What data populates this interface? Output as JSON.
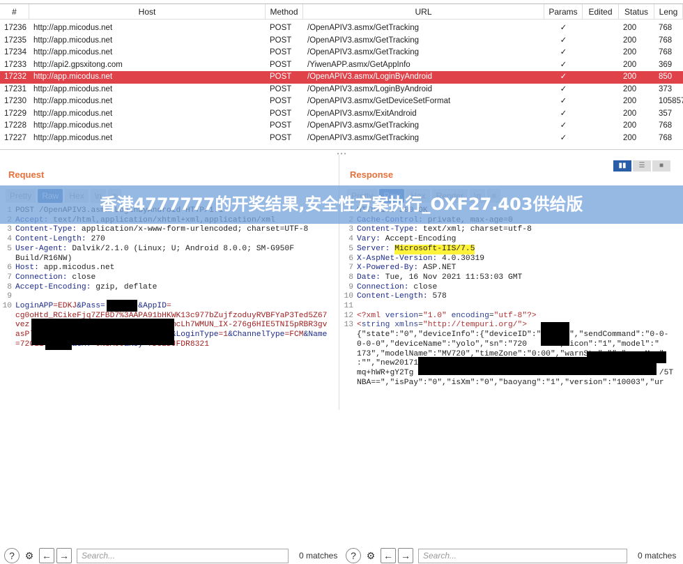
{
  "table": {
    "columns": [
      "#",
      "Host",
      "Method",
      "URL",
      "Params",
      "Edited",
      "Status",
      "Leng"
    ],
    "sort_icon": "chevron-down-icon",
    "rows": [
      {
        "id": "17236",
        "host": "http://app.micodus.net",
        "method": "POST",
        "url": "/OpenAPIV3.asmx/GetTracking",
        "params": "✓",
        "edited": "",
        "status": "200",
        "length": "768"
      },
      {
        "id": "17235",
        "host": "http://app.micodus.net",
        "method": "POST",
        "url": "/OpenAPIV3.asmx/GetTracking",
        "params": "✓",
        "edited": "",
        "status": "200",
        "length": "768"
      },
      {
        "id": "17234",
        "host": "http://app.micodus.net",
        "method": "POST",
        "url": "/OpenAPIV3.asmx/GetTracking",
        "params": "✓",
        "edited": "",
        "status": "200",
        "length": "768"
      },
      {
        "id": "17233",
        "host": "http://api2.gpsxitong.com",
        "method": "POST",
        "url": "/YiwenAPP.asmx/GetAppInfo",
        "params": "✓",
        "edited": "",
        "status": "200",
        "length": "369"
      },
      {
        "id": "17232",
        "host": "http://app.micodus.net",
        "method": "POST",
        "url": "/OpenAPIV3.asmx/LoginByAndroid",
        "params": "✓",
        "edited": "",
        "status": "200",
        "length": "850",
        "selected": true
      },
      {
        "id": "17231",
        "host": "http://app.micodus.net",
        "method": "POST",
        "url": "/OpenAPIV3.asmx/LoginByAndroid",
        "params": "✓",
        "edited": "",
        "status": "200",
        "length": "373"
      },
      {
        "id": "17230",
        "host": "http://app.micodus.net",
        "method": "POST",
        "url": "/OpenAPIV3.asmx/GetDeviceSetFormat",
        "params": "✓",
        "edited": "",
        "status": "200",
        "length": "105857"
      },
      {
        "id": "17229",
        "host": "http://app.micodus.net",
        "method": "POST",
        "url": "/OpenAPIV3.asmx/ExitAndroid",
        "params": "✓",
        "edited": "",
        "status": "200",
        "length": "357"
      },
      {
        "id": "17228",
        "host": "http://app.micodus.net",
        "method": "POST",
        "url": "/OpenAPIV3.asmx/GetTracking",
        "params": "✓",
        "edited": "",
        "status": "200",
        "length": "768"
      },
      {
        "id": "17227",
        "host": "http://app.micodus.net",
        "method": "POST",
        "url": "/OpenAPIV3.asmx/GetTracking",
        "params": "✓",
        "edited": "",
        "status": "200",
        "length": "768"
      }
    ]
  },
  "selected_color": "#e0424a",
  "banner": "香港4777777的开奖结果,安全性方案执行_OXF27.403供给版",
  "request": {
    "title": "Request",
    "tabs": [
      "Pretty",
      "Raw",
      "Hex",
      "\\n",
      "≡"
    ],
    "active_tab": "Raw",
    "lines": [
      {
        "n": "1",
        "seg": [
          {
            "c": "v",
            "t": "POST /OpenAPIV3.asmx/LoginByAndroid HTTP/1.1"
          }
        ]
      },
      {
        "n": "2",
        "seg": [
          {
            "c": "k",
            "t": "Accept: "
          },
          {
            "c": "v",
            "t": "text/html,application/xhtml+xml,application/xml"
          }
        ]
      },
      {
        "n": "3",
        "seg": [
          {
            "c": "k",
            "t": "Content-Type: "
          },
          {
            "c": "v",
            "t": "application/x-www-form-urlencoded; charset=UTF-8"
          }
        ]
      },
      {
        "n": "4",
        "seg": [
          {
            "c": "k",
            "t": "Content-Length: "
          },
          {
            "c": "v",
            "t": "270"
          }
        ]
      },
      {
        "n": "5",
        "seg": [
          {
            "c": "k",
            "t": "User-Agent: "
          },
          {
            "c": "v",
            "t": "Dalvik/2.1.0 (Linux; U; Android 8.0.0; SM-G950F"
          }
        ]
      },
      {
        "n": "",
        "seg": [
          {
            "c": "v",
            "t": "Build/R16NW)"
          }
        ]
      },
      {
        "n": "6",
        "seg": [
          {
            "c": "k",
            "t": "Host: "
          },
          {
            "c": "v",
            "t": "app.micodus.net"
          }
        ]
      },
      {
        "n": "7",
        "seg": [
          {
            "c": "k",
            "t": "Connection: "
          },
          {
            "c": "v",
            "t": "close"
          }
        ]
      },
      {
        "n": "8",
        "seg": [
          {
            "c": "k",
            "t": "Accept-Encoding: "
          },
          {
            "c": "v",
            "t": "gzip, deflate"
          }
        ]
      },
      {
        "n": "9",
        "seg": []
      },
      {
        "n": "10",
        "seg": [
          {
            "c": "k",
            "t": "LoginAPP"
          },
          {
            "c": "b",
            "t": "=EDKJ"
          },
          {
            "c": "k",
            "t": "&Pass="
          },
          {
            "c": "b",
            "t": "       "
          },
          {
            "c": "k",
            "t": "&AppID"
          },
          {
            "c": "b",
            "t": "="
          }
        ]
      },
      {
        "n": "",
        "seg": [
          {
            "c": "b",
            "t": "cg0oHtd_RCikeFjq7ZFBD7%3AAPA91bHKWK13c977bZujfzoduyRVBFYaP3Ted5Z67"
          }
        ]
      },
      {
        "n": "",
        "seg": [
          {
            "c": "b",
            "t": "vez                              mcLh7WMUN_IX-276g6HIE5TNI5pRBR3gv"
          }
        ]
      },
      {
        "n": "",
        "seg": [
          {
            "c": "b",
            "t": "asPlq                            "
          },
          {
            "c": "k",
            "t": "&LoginType"
          },
          {
            "c": "b",
            "t": "=1"
          },
          {
            "c": "k",
            "t": "&ChannelType"
          },
          {
            "c": "b",
            "t": "=FCM"
          },
          {
            "c": "k",
            "t": "&Name"
          }
        ]
      },
      {
        "n": "",
        "seg": [
          {
            "c": "b",
            "t": "=72011      "
          },
          {
            "c": "k",
            "t": "&GMT"
          },
          {
            "c": "b",
            "t": "=0%3A00"
          },
          {
            "c": "k",
            "t": "&Key"
          },
          {
            "c": "b",
            "t": "=7DU2DJFDR8321"
          }
        ]
      }
    ]
  },
  "response": {
    "title": "Response",
    "tabs": [
      "Pretty",
      "Raw",
      "Hex",
      "Render",
      "\\n",
      "≡"
    ],
    "active_tab": "Raw",
    "lines": [
      {
        "n": "1",
        "seg": [
          {
            "c": "v",
            "t": "HTTP/1.1 200 OK"
          }
        ]
      },
      {
        "n": "2",
        "seg": [
          {
            "c": "k",
            "t": "Cache-Control: "
          },
          {
            "c": "v",
            "t": "private, max-age=0"
          }
        ]
      },
      {
        "n": "3",
        "seg": [
          {
            "c": "k",
            "t": "Content-Type: "
          },
          {
            "c": "v",
            "t": "text/xml; charset=utf-8"
          }
        ]
      },
      {
        "n": "4",
        "seg": [
          {
            "c": "k",
            "t": "Vary: "
          },
          {
            "c": "v",
            "t": "Accept-Encoding"
          }
        ]
      },
      {
        "n": "5",
        "seg": [
          {
            "c": "k",
            "t": "Server: "
          },
          {
            "c": "hl",
            "t": "Microsoft-IIS/7.5"
          }
        ]
      },
      {
        "n": "6",
        "seg": [
          {
            "c": "k",
            "t": "X-AspNet-Version: "
          },
          {
            "c": "v",
            "t": "4.0.30319"
          }
        ]
      },
      {
        "n": "7",
        "seg": [
          {
            "c": "k",
            "t": "X-Powered-By: "
          },
          {
            "c": "v",
            "t": "ASP.NET"
          }
        ]
      },
      {
        "n": "8",
        "seg": [
          {
            "c": "k",
            "t": "Date: "
          },
          {
            "c": "v",
            "t": "Tue, 16 Nov 2021 11:53:03 GMT"
          }
        ]
      },
      {
        "n": "9",
        "seg": [
          {
            "c": "k",
            "t": "Connection: "
          },
          {
            "c": "v",
            "t": "close"
          }
        ]
      },
      {
        "n": "10",
        "seg": [
          {
            "c": "k",
            "t": "Content-Length: "
          },
          {
            "c": "v",
            "t": "578"
          }
        ]
      },
      {
        "n": "11",
        "seg": []
      },
      {
        "n": "12",
        "seg": [
          {
            "c": "s",
            "t": "<?xml "
          },
          {
            "c": "x",
            "t": "version"
          },
          {
            "c": "v",
            "t": "="
          },
          {
            "c": "s",
            "t": "\"1.0\" "
          },
          {
            "c": "x",
            "t": "encoding"
          },
          {
            "c": "v",
            "t": "="
          },
          {
            "c": "s",
            "t": "\"utf-8\"?>"
          }
        ]
      },
      {
        "n": "13",
        "seg": [
          {
            "c": "s",
            "t": "<"
          },
          {
            "c": "x",
            "t": "string xmlns"
          },
          {
            "c": "v",
            "t": "="
          },
          {
            "c": "s",
            "t": "\"http://tempuri.org/\">"
          }
        ]
      },
      {
        "n": "",
        "seg": [
          {
            "c": "v",
            "t": "{\"state\":\"0\",\"deviceInfo\":{\"deviceID\":\"      \",\"sendCommand\":\"0-0-"
          }
        ]
      },
      {
        "n": "",
        "seg": [
          {
            "c": "v",
            "t": "0-0-0\",\"deviceName\":\"yolo\",\"sn\":\"720      \",\"icon\":\"1\",\"model\":\""
          }
        ]
      },
      {
        "n": "",
        "seg": [
          {
            "c": "v",
            "t": "173\",\"modelName\":\"MV720\",\"timeZone\":\"0:00\",\"warnStr\":\"\",\"warnMsg\""
          }
        ]
      },
      {
        "n": "",
        "seg": [
          {
            "c": "v",
            "t": ":\"\",\"new201710\":\"1\",\"new201803\":\"1\",\"key2018\":\"i"
          }
        ]
      },
      {
        "n": "",
        "seg": [
          {
            "c": "v",
            "t": "mq+hWR+gY2Tg                                                    /5T"
          }
        ]
      },
      {
        "n": "",
        "seg": [
          {
            "c": "v",
            "t": "NBA==\",\"isPay\":\"0\",\"isXm\":\"0\",\"baoyang\":\"1\",\"version\":\"10003\",\"ur"
          }
        ]
      }
    ]
  },
  "search": {
    "placeholder": "Search...",
    "matches": "0 matches"
  },
  "icons": [
    "help-icon",
    "settings-icon",
    "arrow-left-icon",
    "arrow-right-icon"
  ]
}
